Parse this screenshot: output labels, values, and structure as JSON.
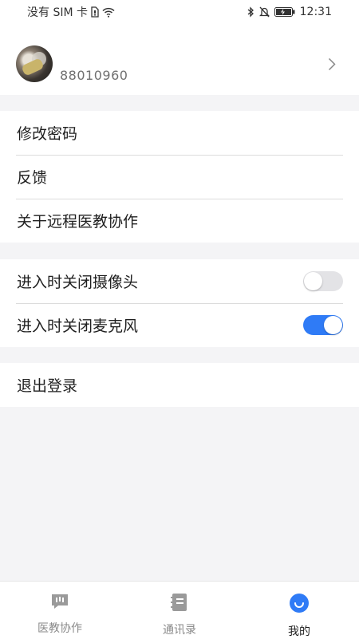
{
  "status_bar": {
    "carrier": "没有 SIM 卡",
    "time": "12:31",
    "icons": [
      "sim-icon",
      "wifi-icon",
      "bluetooth-icon",
      "mute-icon",
      "battery-icon"
    ]
  },
  "profile": {
    "user_id": "88010960"
  },
  "menu": {
    "change_password": "修改密码",
    "feedback": "反馈",
    "about": "关于远程医教协作"
  },
  "settings": {
    "camera_label": "进入时关闭摄像头",
    "camera_on": false,
    "mic_label": "进入时关闭麦克风",
    "mic_on": true
  },
  "logout": {
    "label": "退出登录"
  },
  "bottom_nav": {
    "items": [
      {
        "label": "医教协作",
        "active": false
      },
      {
        "label": "通讯录",
        "active": false
      },
      {
        "label": "我的",
        "active": true
      }
    ]
  },
  "colors": {
    "accent": "#2f7bf6",
    "toggle_off": "#e3e3e6",
    "icon_inactive": "#9a9a9a",
    "page_bg": "#f4f4f6"
  }
}
